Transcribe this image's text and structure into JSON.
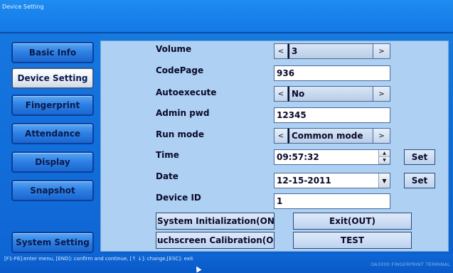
{
  "window": {
    "title": "Device Setting"
  },
  "nav": {
    "items": [
      {
        "label": "Basic Info"
      },
      {
        "label": "Device Setting"
      },
      {
        "label": "Fingerprint"
      },
      {
        "label": "Attendance"
      },
      {
        "label": "Display"
      },
      {
        "label": "Snapshot"
      }
    ],
    "system_setting": "System Setting"
  },
  "form": {
    "volume": {
      "label": "Volume",
      "value": "3",
      "prev": "<",
      "next": ">"
    },
    "codepage": {
      "label": "CodePage",
      "value": "936"
    },
    "autoexecute": {
      "label": "Autoexecute",
      "value": "No",
      "prev": "<",
      "next": ">"
    },
    "admin_pwd": {
      "label": "Admin pwd",
      "value": "12345"
    },
    "run_mode": {
      "label": "Run mode",
      "value": "Common mode",
      "prev": "<",
      "next": ">"
    },
    "time": {
      "label": "Time",
      "value": "09:57:32",
      "set": "Set"
    },
    "date": {
      "label": "Date",
      "value": "12-15-2011",
      "set": "Set"
    },
    "device_id": {
      "label": "Device ID",
      "value": "1"
    }
  },
  "actions": {
    "system_init": "System Initialization(ON)",
    "exit": "Exit(OUT)",
    "touch_calib": "uchscreen Calibration(OF",
    "test": "TEST"
  },
  "status": {
    "hint": "[F1-F6]:enter menu, [END]: confirm and continue, [↑ ↓]: change,[ESC]: exit",
    "brand": "OA3000 FINGERPRINT TERMINAL"
  }
}
